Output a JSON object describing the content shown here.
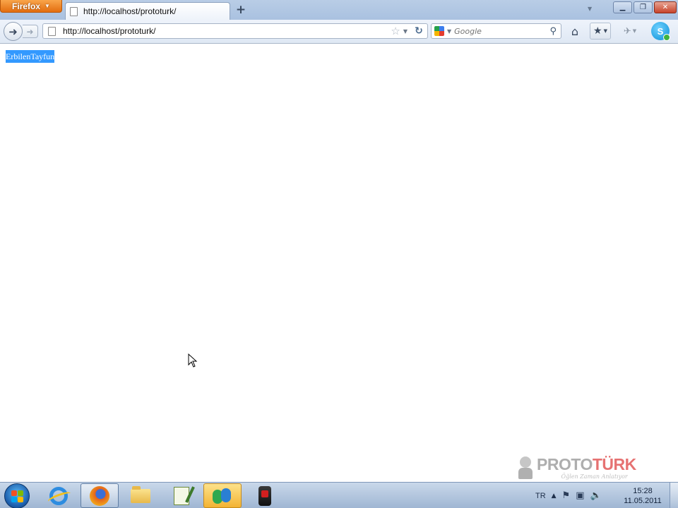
{
  "browser": {
    "menu_button_label": "Firefox",
    "tab": {
      "title": "http://localhost/prototurk/"
    },
    "new_tab_label": "+",
    "url": "http://localhost/prototurk/",
    "search": {
      "engine_icon": "google-icon",
      "placeholder": "Google"
    }
  },
  "page": {
    "selected_text": "ErbilenTayfun"
  },
  "watermark": {
    "brand_part1": "PROTO",
    "brand_part2": "TÜRK",
    "slogan": "Öğlen Zaman Anlatıyor"
  },
  "taskbar": {
    "apps": [
      {
        "name": "internet-explorer",
        "icon": "ie-icon"
      },
      {
        "name": "firefox",
        "icon": "firefox-icon",
        "active": true
      },
      {
        "name": "windows-explorer",
        "icon": "folder-icon"
      },
      {
        "name": "notepad-plus-plus",
        "icon": "notepad-icon"
      },
      {
        "name": "windows-live-messenger",
        "icon": "messenger-icon"
      },
      {
        "name": "camtasia-recorder",
        "icon": "recorder-icon"
      }
    ],
    "tray": {
      "language": "TR"
    },
    "clock": {
      "time": "15:28",
      "date": "11.05.2011"
    }
  },
  "colors": {
    "selection": "#3399ff",
    "firefox_orange": "#e36d0f",
    "taskbar": "#9fb6d3"
  }
}
